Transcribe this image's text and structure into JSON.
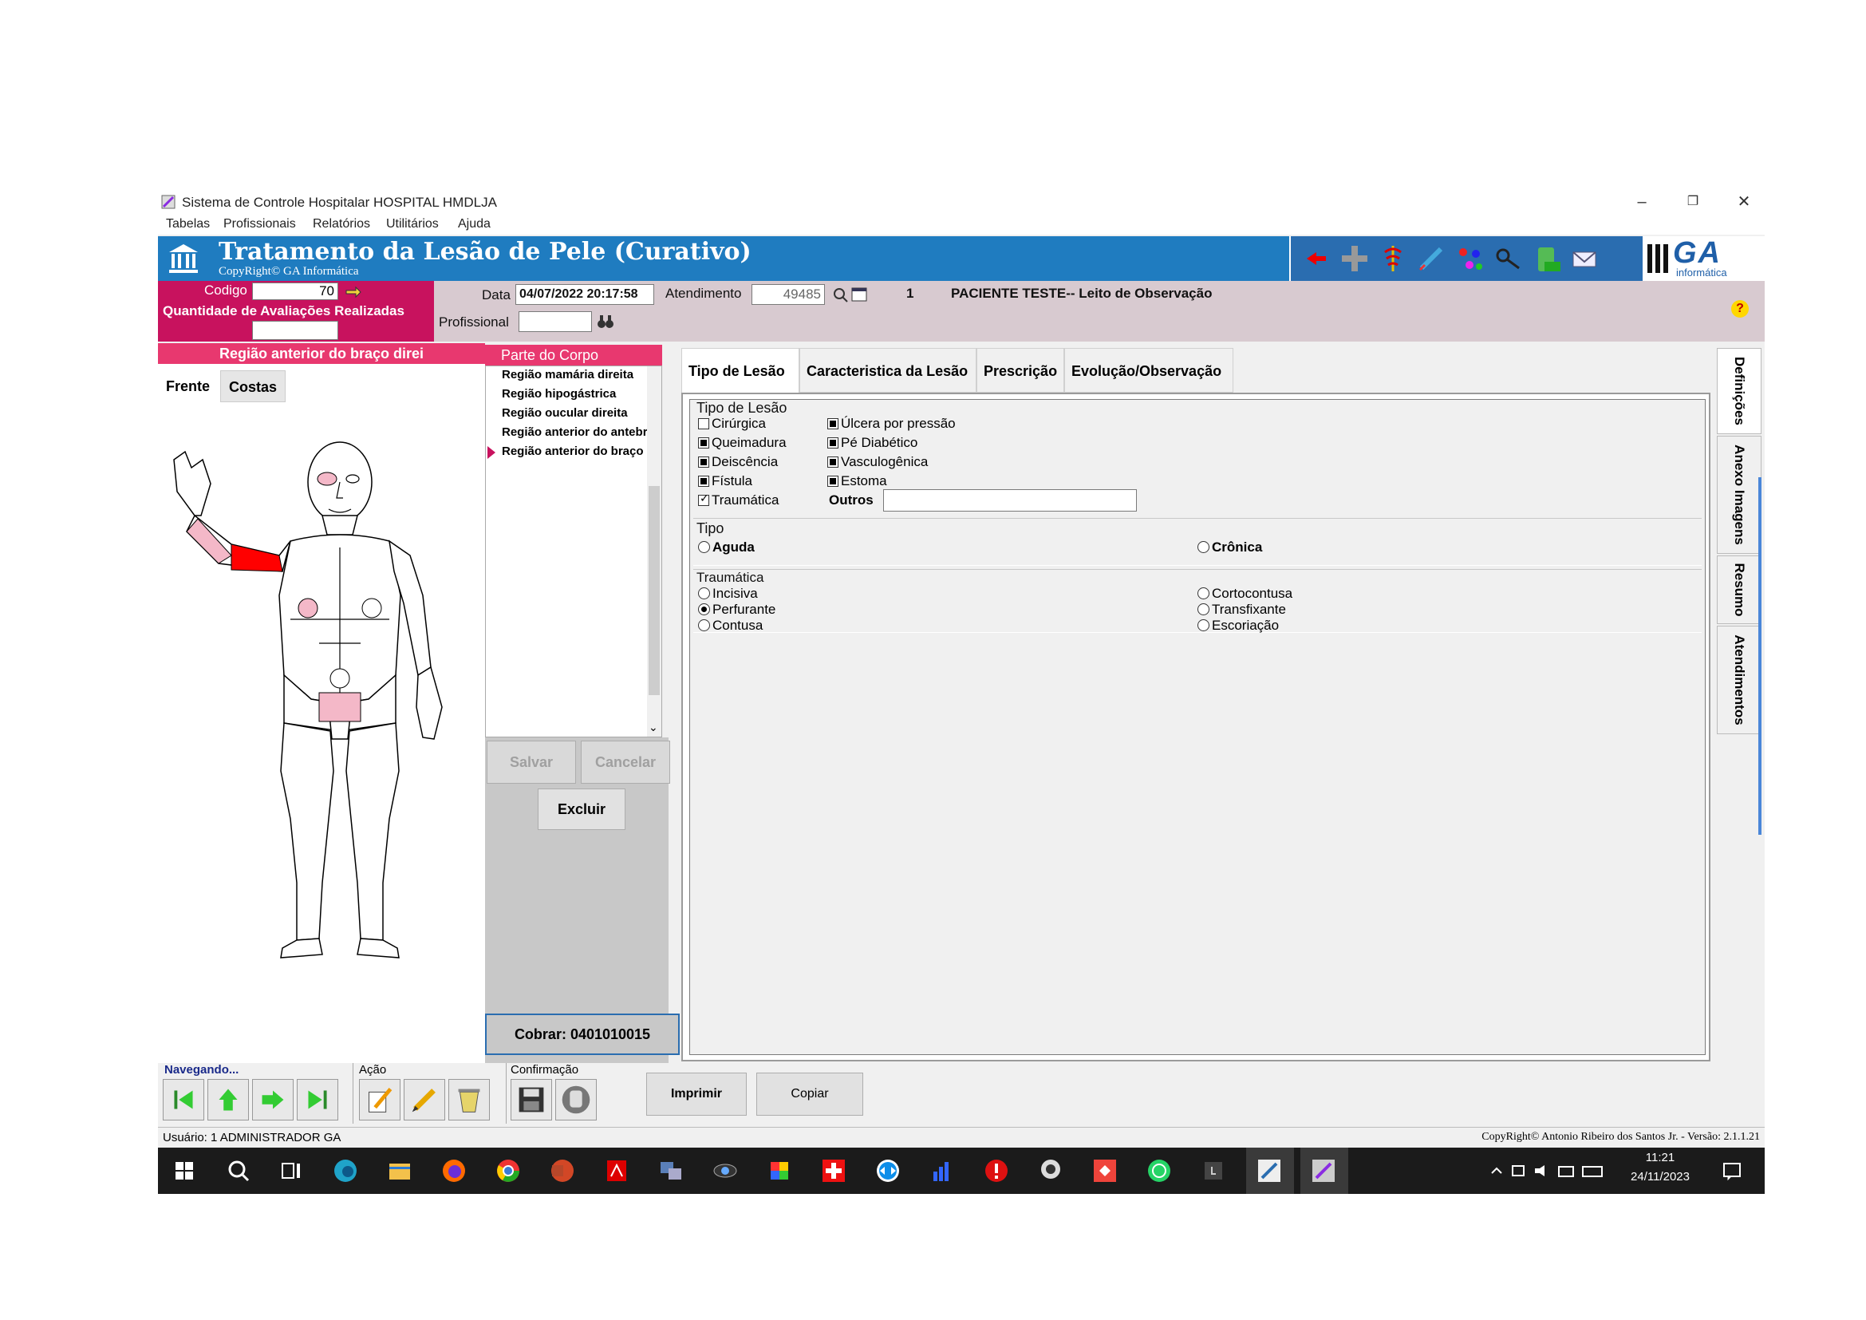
{
  "window": {
    "title": "Sistema de Controle Hospitalar HOSPITAL HMDLJA",
    "controls": {
      "minimize": "–",
      "restore": "❐",
      "close": "✕"
    }
  },
  "menu": [
    "Tabelas",
    "Profissionais",
    "Relatórios",
    "Utilitários",
    "Ajuda"
  ],
  "header": {
    "title": "Tratamento da Lesão de Pele (Curativo)",
    "copyright": "CopyRight© GA Informática",
    "brand": "GA",
    "brand_sub": "informática"
  },
  "info": {
    "codigo_label": "Codigo",
    "codigo_value": "70",
    "avaliacoes_label": "Quantidade de Avaliações Realizadas",
    "avaliacoes_value": "",
    "data_label": "Data",
    "data_value": "04/07/2022 20:17:58",
    "atendimento_label": "Atendimento",
    "atendimento_value": "49485",
    "count": "1",
    "paciente": "PACIENTE TESTE-- Leito de Observação",
    "profissional_label": "Profissional",
    "profissional_value": "",
    "help": "?"
  },
  "left": {
    "region_title": "Região anterior do braço direi",
    "tab_front": "Frente",
    "tab_back": "Costas"
  },
  "partes": {
    "title": "Parte do Corpo",
    "items": [
      "Região mamária direita",
      "Região hipogástrica",
      "Região oucular direita",
      "Região anterior do antebraço",
      "Região anterior do braço direito"
    ],
    "selected_index": 4,
    "salvar": "Salvar",
    "cancelar": "Cancelar",
    "excluir": "Excluir",
    "cobrar": "Cobrar: 0401010015"
  },
  "tabs": [
    "Tipo de Lesão",
    "Caracteristica da Lesão",
    "Prescrição",
    "Evolução/Observação"
  ],
  "tipo_lesao": {
    "group_title": "Tipo de Lesão",
    "col1": [
      {
        "label": "Cirúrgica",
        "state": "empty"
      },
      {
        "label": "Queimadura",
        "state": "fill"
      },
      {
        "label": "Deiscência",
        "state": "fill"
      },
      {
        "label": "Fístula",
        "state": "fill"
      },
      {
        "label": "Traumática",
        "state": "check"
      }
    ],
    "col2": [
      {
        "label": "Úlcera por pressão",
        "state": "fill"
      },
      {
        "label": "Pé Diabético",
        "state": "fill"
      },
      {
        "label": "Vasculogênica",
        "state": "fill"
      },
      {
        "label": "Estoma",
        "state": "fill"
      }
    ],
    "outros_label": "Outros",
    "outros_value": ""
  },
  "tipo": {
    "group_title": "Tipo",
    "aguda": "Aguda",
    "cronica": "Crônica"
  },
  "traumatica": {
    "group_title": "Traumática",
    "col1": [
      {
        "label": "Incisiva",
        "on": false
      },
      {
        "label": "Perfurante",
        "on": true
      },
      {
        "label": "Contusa",
        "on": false
      }
    ],
    "col2": [
      {
        "label": "Cortocontusa",
        "on": false
      },
      {
        "label": "Transfixante",
        "on": false
      },
      {
        "label": "Escoriação",
        "on": false
      }
    ]
  },
  "side_tabs": [
    "Definições",
    "Anexo Imagens",
    "Resumo",
    "Atendimentos"
  ],
  "bottom": {
    "navegando": "Navegando...",
    "acao": "Ação",
    "confirmacao": "Confirmação",
    "imprimir": "Imprimir",
    "copiar": "Copiar"
  },
  "status": {
    "usuario": "Usuário: 1  ADMINISTRADOR GA",
    "version": "CopyRight© Antonio Ribeiro dos Santos Jr. - Versão: 2.1.1.21"
  },
  "taskbar": {
    "time": "11:21",
    "date": "24/11/2023"
  },
  "colors": {
    "header_blue": "#1f7cc0",
    "magenta": "#c8125e",
    "pink": "#e8386f",
    "lesion_red": "#ff0000",
    "lesion_pink": "#f4b8c8"
  }
}
